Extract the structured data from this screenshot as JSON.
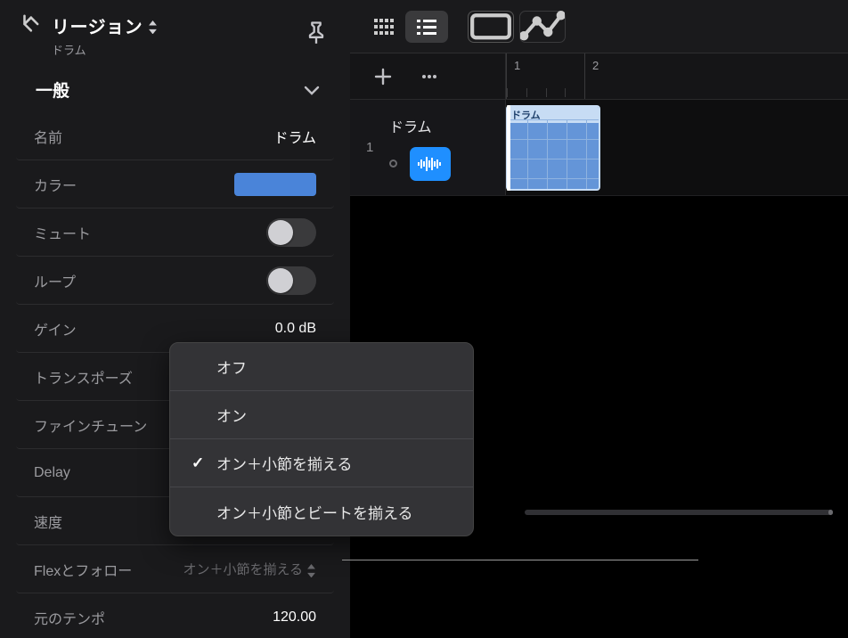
{
  "inspector": {
    "title": "リージョン",
    "subtitle": "ドラム",
    "section": "一般",
    "rows": {
      "name_label": "名前",
      "name_value": "ドラム",
      "color_label": "カラー",
      "color_hex": "#4a84d9",
      "mute_label": "ミュート",
      "loop_label": "ループ",
      "gain_label": "ゲイン",
      "gain_value": "0.0 dB",
      "transpose_label": "トランスポーズ",
      "finetune_label": "ファインチューン",
      "delay_label": "Delay",
      "speed_label": "速度",
      "flex_label": "Flexとフォロー",
      "flex_value": "オン＋小節を揃える",
      "origtempo_label": "元のテンポ",
      "origtempo_value": "120.00"
    }
  },
  "popup": {
    "items": [
      {
        "label": "オフ",
        "checked": false
      },
      {
        "label": "オン",
        "checked": false
      },
      {
        "label": "オン＋小節を揃える",
        "checked": true
      },
      {
        "label": "オン＋小節とビートを揃える",
        "checked": false
      }
    ]
  },
  "main": {
    "ruler_marks": [
      "1",
      "2"
    ],
    "track": {
      "index": "1",
      "name": "ドラム",
      "region_name": "ドラム"
    }
  }
}
